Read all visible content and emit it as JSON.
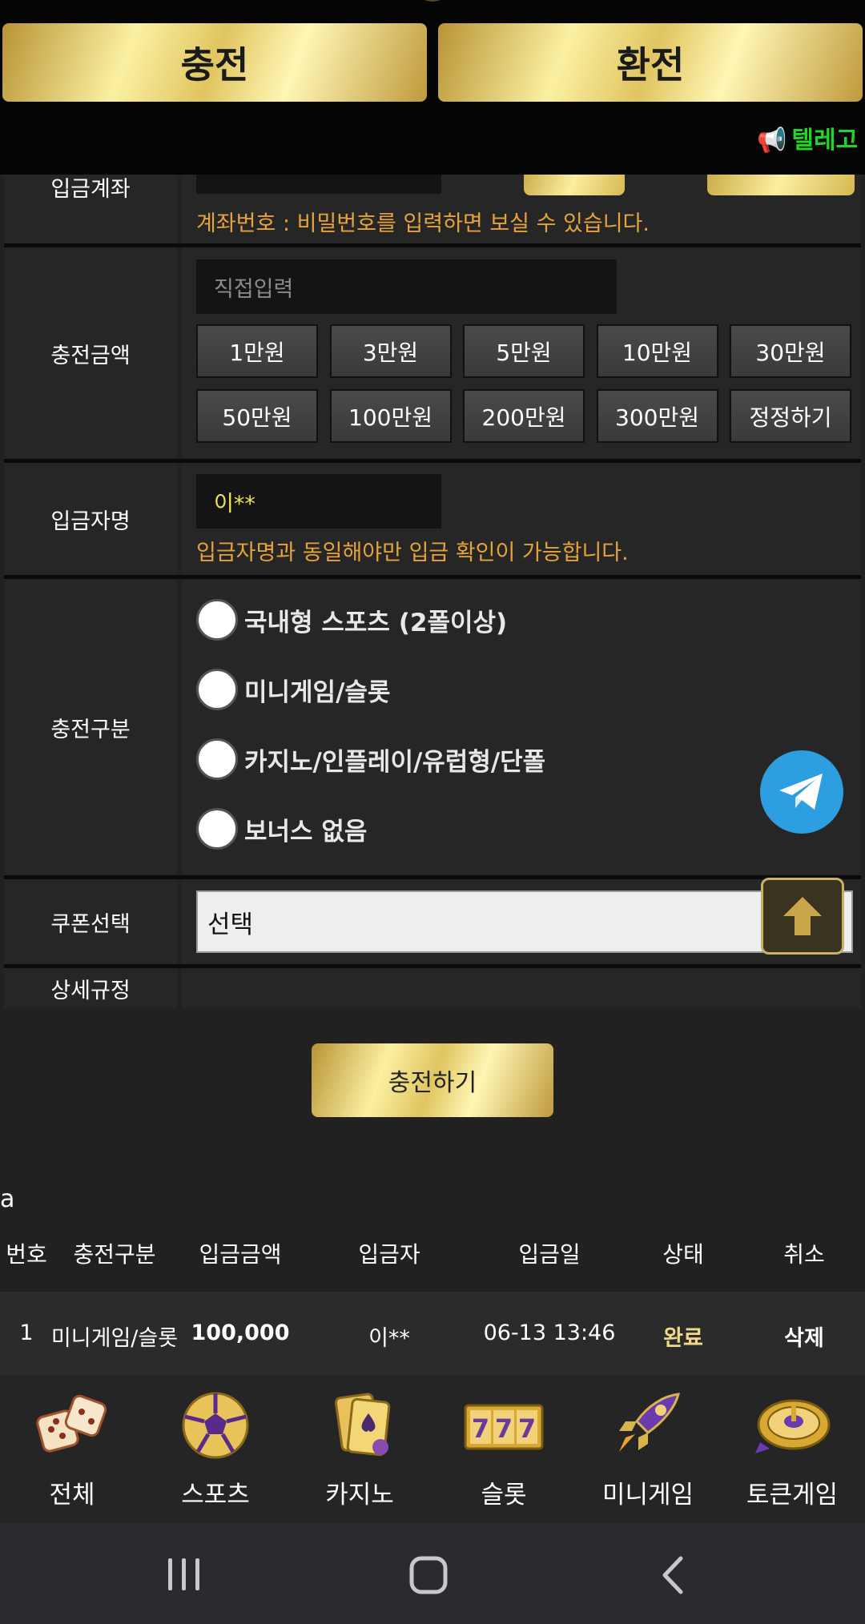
{
  "header": {
    "charge_label": "충전",
    "exchange_label": "환전",
    "marquee_text": "텔레고"
  },
  "form": {
    "account": {
      "label": "입금계좌",
      "hint": "계좌번호 : 비밀번호를 입력하면 보실 수 있습니다."
    },
    "amount": {
      "label": "충전금액",
      "placeholder": "직접입력",
      "buttons": [
        "1만원",
        "3만원",
        "5만원",
        "10만원",
        "30만원",
        "50만원",
        "100만원",
        "200만원",
        "300만원",
        "정정하기"
      ]
    },
    "depositor": {
      "label": "입금자명",
      "value": "이**",
      "hint": "입금자명과 동일해야만 입금 확인이 가능합니다."
    },
    "type": {
      "label": "충전구분",
      "options": [
        "국내형 스포츠 (2폴이상)",
        "미니게임/슬롯",
        "카지노/인플레이/유럽형/단폴",
        "보너스 없음"
      ]
    },
    "coupon": {
      "label": "쿠폰선택",
      "value": "선택"
    },
    "rules": {
      "label": "상세규정"
    },
    "submit_label": "충전하기"
  },
  "history": {
    "title": "a",
    "columns": [
      "번호",
      "충전구분",
      "입금금액",
      "입금자",
      "입금일",
      "상태",
      "취소"
    ],
    "rows": [
      [
        "1",
        "미니게임/슬롯",
        "100,000",
        "이**",
        "06-13 13:46",
        "완료",
        "삭제"
      ]
    ]
  },
  "bottom_nav": [
    {
      "label": "전체",
      "icon": "dice-icon"
    },
    {
      "label": "스포츠",
      "icon": "soccer-ball-icon"
    },
    {
      "label": "카지노",
      "icon": "playing-cards-icon"
    },
    {
      "label": "슬롯",
      "icon": "slot-777-icon"
    },
    {
      "label": "미니게임",
      "icon": "rocket-icon"
    },
    {
      "label": "토큰게임",
      "icon": "roulette-icon"
    }
  ],
  "colors": {
    "gold": "#e8d27a",
    "hint": "#e6a33c",
    "status_done": "#f2d98a",
    "telegram": "#2d9fe0",
    "marquee": "#22d428"
  }
}
